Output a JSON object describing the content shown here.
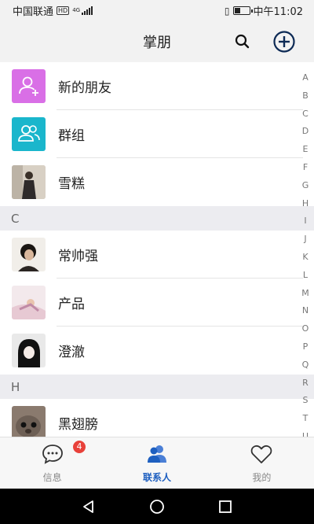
{
  "status_bar": {
    "carrier": "中国联通",
    "hd": "HD",
    "network": "4G",
    "time": "中午11:02"
  },
  "header": {
    "title": "掌朋"
  },
  "contacts": {
    "special": [
      {
        "label": "新的朋友",
        "icon": "add-user-icon",
        "color": "#d96fe6"
      },
      {
        "label": "群组",
        "icon": "group-icon",
        "color": "#1ab6cc"
      }
    ],
    "top_contacts": [
      {
        "label": "雪糕"
      }
    ],
    "sections": [
      {
        "letter": "C",
        "items": [
          {
            "label": "常帅强"
          },
          {
            "label": "产品"
          },
          {
            "label": "澄澈"
          }
        ]
      },
      {
        "letter": "H",
        "items": [
          {
            "label": "黑翅膀"
          }
        ]
      }
    ]
  },
  "index_letters": [
    "A",
    "B",
    "C",
    "D",
    "E",
    "F",
    "G",
    "H",
    "I",
    "J",
    "K",
    "L",
    "M",
    "N",
    "O",
    "P",
    "Q",
    "R",
    "S",
    "T",
    "U"
  ],
  "tabbar": {
    "tabs": [
      {
        "label": "信息",
        "icon": "chat-icon",
        "badge": "4"
      },
      {
        "label": "联系人",
        "icon": "contacts-icon",
        "active": true
      },
      {
        "label": "我的",
        "icon": "heart-icon"
      }
    ]
  },
  "colors": {
    "accent": "#1e5fc0",
    "badge": "#e8413a"
  }
}
